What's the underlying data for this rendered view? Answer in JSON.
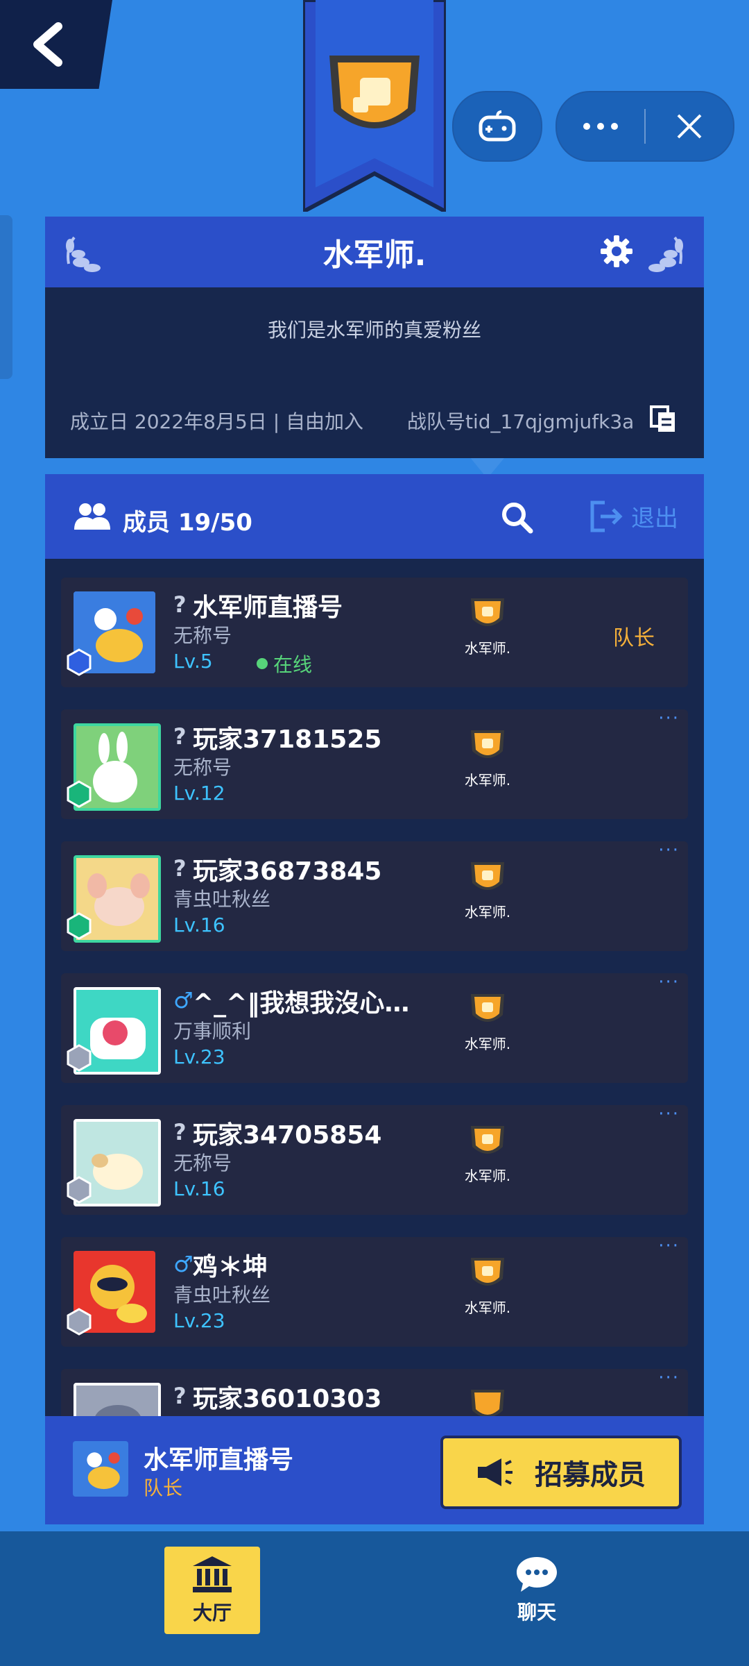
{
  "team": {
    "name": "水军师.",
    "description": "我们是水军师的真爱粉丝",
    "founded": "成立日 2022年8月5日 | 自由加入",
    "team_id": "战队号tid_17qjgmjufk3a"
  },
  "members_header": {
    "label": "成员 19/50",
    "exit_label": "退出"
  },
  "members": [
    {
      "gender": "?",
      "name": "水军师直播号",
      "title": "无称号",
      "level": "Lv.5",
      "online": "在线",
      "team": "水军师.",
      "role": "队长",
      "more": "",
      "avatar_color": "#3a7de0",
      "badge": "blue"
    },
    {
      "gender": "?",
      "name": "玩家37181525",
      "title": "无称号",
      "level": "Lv.12",
      "online": "",
      "team": "水军师.",
      "role": "",
      "more": "···",
      "avatar_color": "#7fd17b",
      "badge": "green"
    },
    {
      "gender": "?",
      "name": "玩家36873845",
      "title": "青虫吐秋丝",
      "level": "Lv.16",
      "online": "",
      "team": "水军师.",
      "role": "",
      "more": "···",
      "avatar_color": "#f4d889",
      "badge": "green"
    },
    {
      "gender": "♂",
      "name": "^_^‖我想我沒心…",
      "title": "万事顺利",
      "level": "Lv.23",
      "online": "",
      "team": "水军师.",
      "role": "",
      "more": "···",
      "avatar_color": "#3ed7c4",
      "badge": "gray"
    },
    {
      "gender": "?",
      "name": "玩家34705854",
      "title": "无称号",
      "level": "Lv.16",
      "online": "",
      "team": "水军师.",
      "role": "",
      "more": "···",
      "avatar_color": "#bfe6e1",
      "badge": "gray"
    },
    {
      "gender": "♂",
      "name": "鸡＊坤",
      "title": "青虫吐秋丝",
      "level": "Lv.23",
      "online": "",
      "team": "水军师.",
      "role": "",
      "more": "···",
      "avatar_color": "#e8362d",
      "badge": "gray"
    },
    {
      "gender": "?",
      "name": "玩家36010303",
      "title": "",
      "level": "",
      "online": "",
      "team": "",
      "role": "",
      "more": "···",
      "avatar_color": "#9aa3b8",
      "badge": ""
    }
  ],
  "self": {
    "name": "水军师直播号",
    "role": "队长"
  },
  "recruit_label": "招募成员",
  "nav": {
    "hall": "大厅",
    "chat": "聊天"
  },
  "colors": {
    "background": "#2f86e4",
    "panel_dark": "#17274d",
    "panel_blue": "#2b4fc9",
    "accent_yellow": "#f9d54a",
    "leader_orange": "#f6b13a",
    "level_cyan": "#3ec3ff",
    "online_green": "#57d47a"
  },
  "icons": [
    "back-arrow-icon",
    "gamepad-icon",
    "more-dots-icon",
    "close-icon",
    "laurel-icon",
    "gear-icon",
    "copy-icon",
    "members-icon",
    "search-icon",
    "exit-icon",
    "megaphone-icon",
    "bank-icon",
    "chat-bubble-icon"
  ]
}
